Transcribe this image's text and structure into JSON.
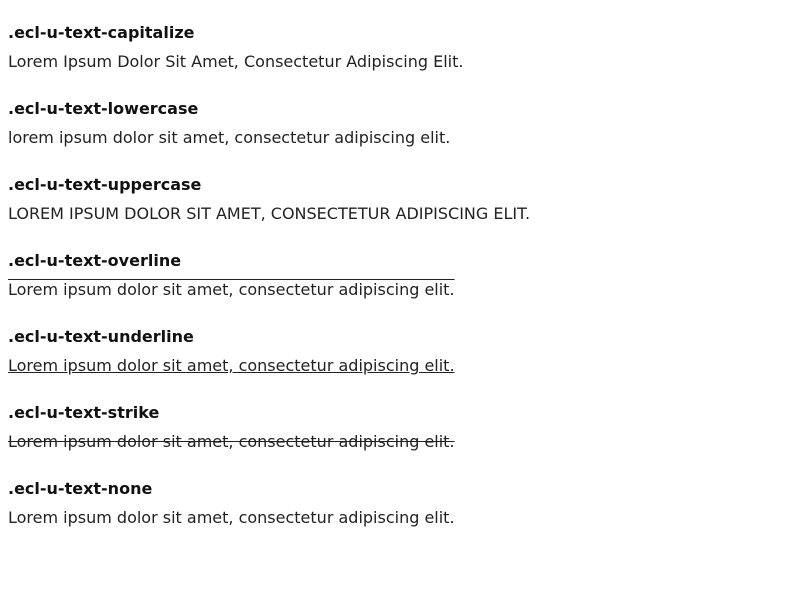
{
  "examples": [
    {
      "title": ".ecl-u-text-capitalize",
      "text": "Lorem Ipsum Dolor Sit Amet, Consectetur Adipiscing Elit."
    },
    {
      "title": ".ecl-u-text-lowercase",
      "text": "lorem ipsum dolor sit amet, consectetur adipiscing elit."
    },
    {
      "title": ".ecl-u-text-uppercase",
      "text": "LOREM IPSUM DOLOR SIT AMET, CONSECTETUR ADIPISCING ELIT."
    },
    {
      "title": ".ecl-u-text-overline",
      "text": "Lorem ipsum dolor sit amet, consectetur adipiscing elit."
    },
    {
      "title": ".ecl-u-text-underline",
      "text": "Lorem ipsum dolor sit amet, consectetur adipiscing elit."
    },
    {
      "title": ".ecl-u-text-strike",
      "text": "Lorem ipsum dolor sit amet, consectetur adipiscing elit."
    },
    {
      "title": ".ecl-u-text-none",
      "text": "Lorem ipsum dolor sit amet, consectetur adipiscing elit."
    }
  ]
}
